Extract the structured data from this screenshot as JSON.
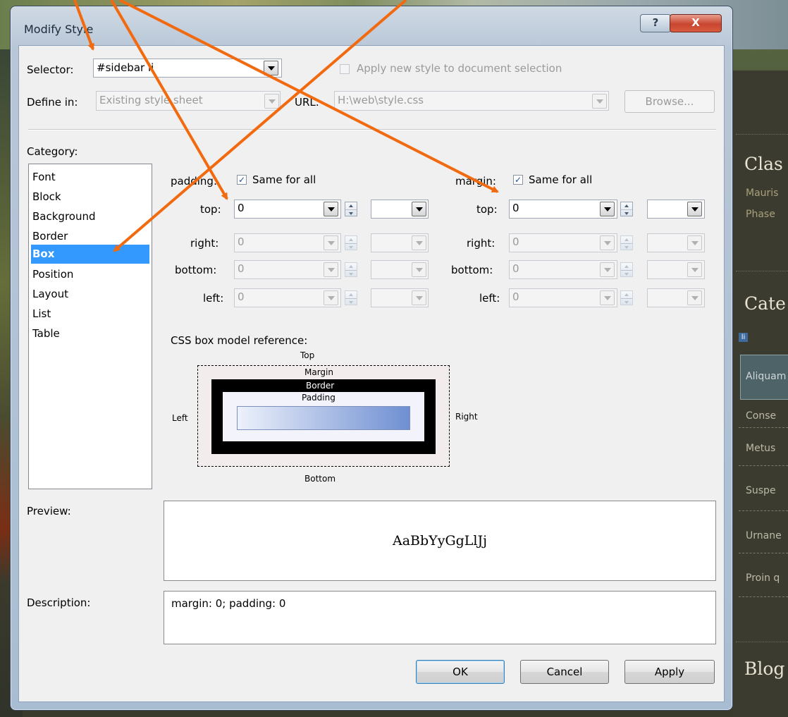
{
  "dialog": {
    "title": "Modify Style",
    "help_label": "?",
    "close_label": "X"
  },
  "selector": {
    "label": "Selector:",
    "value": "#sidebar li",
    "apply_checkbox_label": "Apply new style to document selection",
    "apply_checked": false
  },
  "define_in": {
    "label": "Define in:",
    "value": "Existing style sheet",
    "url_label": "URL:",
    "url_value": "H:\\web\\style.css",
    "browse_label": "Browse..."
  },
  "category": {
    "label": "Category:",
    "items": [
      "Font",
      "Block",
      "Background",
      "Border",
      "Box",
      "Position",
      "Layout",
      "List",
      "Table"
    ],
    "selected": "Box"
  },
  "padding": {
    "label": "padding:",
    "same_for_all_label": "Same for all",
    "same_for_all_checked": true,
    "sides": [
      {
        "label": "top:",
        "value": "0"
      },
      {
        "label": "right:",
        "value": "0"
      },
      {
        "label": "bottom:",
        "value": "0"
      },
      {
        "label": "left:",
        "value": "0"
      }
    ]
  },
  "margin": {
    "label": "margin:",
    "same_for_all_label": "Same for all",
    "same_for_all_checked": true,
    "sides": [
      {
        "label": "top:",
        "value": "0"
      },
      {
        "label": "right:",
        "value": "0"
      },
      {
        "label": "bottom:",
        "value": "0"
      },
      {
        "label": "left:",
        "value": "0"
      }
    ]
  },
  "box_model": {
    "title": "CSS box model reference:",
    "top": "Top",
    "bottom": "Bottom",
    "left": "Left",
    "right": "Right",
    "margin": "Margin",
    "border": "Border",
    "padding": "Padding"
  },
  "preview": {
    "label": "Preview:",
    "sample": "AaBbYyGgLlJj"
  },
  "description": {
    "label": "Description:",
    "value": "margin: 0; padding: 0"
  },
  "buttons": {
    "ok": "OK",
    "cancel": "Cancel",
    "apply": "Apply"
  },
  "background_page": {
    "headings": [
      "Clas",
      "Cate",
      "Blog"
    ],
    "links": [
      "Mauris",
      "Phase"
    ],
    "tag_badge": "li",
    "category_items": [
      "Aliquam",
      "Conse",
      "Metus",
      "Suspe",
      "Urnane",
      "Proin q"
    ]
  },
  "colors": {
    "selection": "#3399ff",
    "annotation_arrow": "#f26a10",
    "page_dark": "#3c3b30"
  },
  "icons": {
    "dropdown": "chevron-down-icon",
    "spinner": "spin-arrows-icon",
    "check": "checkmark-icon"
  }
}
